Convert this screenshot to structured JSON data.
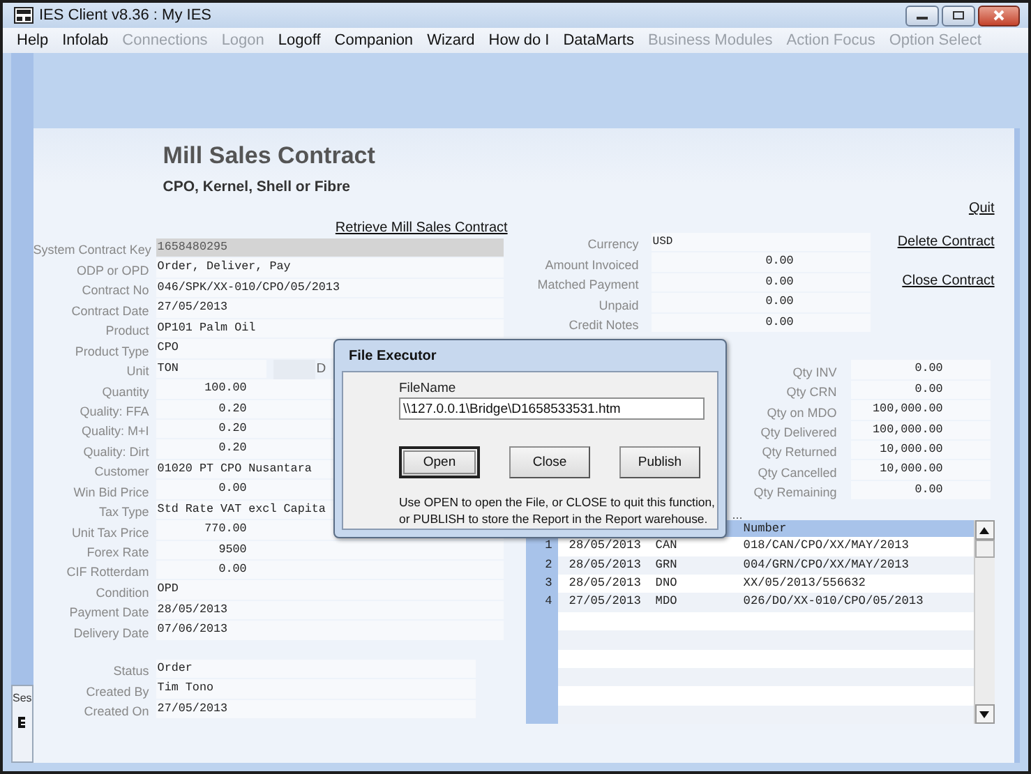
{
  "window": {
    "title": "IES Client v8.36 : My IES"
  },
  "menu": [
    {
      "label": "Help",
      "disabled": false
    },
    {
      "label": "Infolab",
      "disabled": false
    },
    {
      "label": "Connections",
      "disabled": true
    },
    {
      "label": "Logon",
      "disabled": true
    },
    {
      "label": "Logoff",
      "disabled": false
    },
    {
      "label": "Companion",
      "disabled": false
    },
    {
      "label": "Wizard",
      "disabled": false
    },
    {
      "label": "How do I",
      "disabled": false
    },
    {
      "label": "DataMarts",
      "disabled": false
    },
    {
      "label": "Business Modules",
      "disabled": true
    },
    {
      "label": "Action Focus",
      "disabled": true
    },
    {
      "label": "Option Select",
      "disabled": true
    }
  ],
  "form": {
    "title": "Mill Sales Contract",
    "subtitle": "CPO, Kernel, Shell or Fibre",
    "quit_link": "Quit",
    "retrieve_link": "Retrieve Mill Sales Contract",
    "fields": [
      {
        "label": "System Contract Key",
        "value": "1658480295",
        "kind": "key"
      },
      {
        "label": "ODP or OPD",
        "value": "Order, Deliver, Pay",
        "kind": "text"
      },
      {
        "label": "Contract No",
        "value": "046/SPK/XX-010/CPO/05/2013",
        "kind": "text"
      },
      {
        "label": "Contract Date",
        "value": "27/05/2013",
        "kind": "text"
      },
      {
        "label": "Product",
        "value": "OP101 Palm Oil",
        "kind": "text"
      },
      {
        "label": "Product Type",
        "value": "CPO",
        "kind": "text"
      },
      {
        "label": "Unit",
        "value": "TON",
        "kind": "short",
        "side_label": "D"
      },
      {
        "label": "Quantity",
        "value": "100.00",
        "kind": "number"
      },
      {
        "label": "Quality: FFA",
        "value": "0.20",
        "kind": "number"
      },
      {
        "label": "Quality: M+I",
        "value": "0.20",
        "kind": "number"
      },
      {
        "label": "Quality: Dirt",
        "value": "0.20",
        "kind": "number"
      },
      {
        "label": "Customer",
        "value": "01020 PT CPO Nusantara",
        "kind": "text"
      },
      {
        "label": "Win Bid Price",
        "value": "0.00",
        "kind": "number"
      },
      {
        "label": "Tax Type",
        "value": "Std Rate VAT excl Capita",
        "kind": "text"
      },
      {
        "label": "Unit Tax Price",
        "value": "770.00",
        "kind": "number"
      },
      {
        "label": "Forex Rate",
        "value": "9500",
        "kind": "number"
      },
      {
        "label": "CIF Rotterdam",
        "value": "0.00",
        "kind": "number"
      },
      {
        "label": "Condition",
        "value": "OPD",
        "kind": "text"
      },
      {
        "label": "Payment Date",
        "value": "28/05/2013",
        "kind": "text"
      },
      {
        "label": "Delivery Date",
        "value": "07/06/2013",
        "kind": "text"
      }
    ],
    "status_fields": [
      {
        "label": "Status",
        "value": "Order"
      },
      {
        "label": "Created By",
        "value": "Tim Tono"
      },
      {
        "label": "Created On",
        "value": "27/05/2013"
      }
    ],
    "finance_fields": [
      {
        "label": "Currency",
        "value": "USD",
        "kind": "text"
      },
      {
        "label": "Amount Invoiced",
        "value": "0.00",
        "kind": "number"
      },
      {
        "label": "Matched Payment",
        "value": "0.00",
        "kind": "number"
      },
      {
        "label": "Unpaid",
        "value": "0.00",
        "kind": "number"
      },
      {
        "label": "Credit Notes",
        "value": "0.00",
        "kind": "number"
      }
    ],
    "links": [
      "Delete Contract",
      "Close Contract"
    ],
    "quantity_fields": [
      {
        "label": "Qty INV",
        "value": "0.00"
      },
      {
        "label": "Qty CRN",
        "value": "0.00"
      },
      {
        "label": "Qty on MDO",
        "value": "100,000.00"
      },
      {
        "label": "Qty Delivered",
        "value": "100,000.00"
      },
      {
        "label": "Qty Returned",
        "value": "10,000.00"
      },
      {
        "label": "Qty Cancelled",
        "value": "10,000.00"
      },
      {
        "label": "Qty Remaining",
        "value": "0.00"
      }
    ],
    "table": {
      "overflow_label": "...",
      "columns": [
        "Number"
      ],
      "rows": [
        {
          "index": "1",
          "date": "28/05/2013",
          "type": "CAN",
          "number": "018/CAN/CPO/XX/MAY/2013"
        },
        {
          "index": "2",
          "date": "28/05/2013",
          "type": "GRN",
          "number": "004/GRN/CPO/XX/MAY/2013"
        },
        {
          "index": "3",
          "date": "28/05/2013",
          "type": "DNO",
          "number": "XX/05/2013/556632"
        },
        {
          "index": "4",
          "date": "27/05/2013",
          "type": "MDO",
          "number": "026/DO/XX-010/CPO/05/2013"
        }
      ]
    }
  },
  "session_panel": {
    "label": "Ses"
  },
  "dialog": {
    "title": "File Executor",
    "field_label": "FileName",
    "file_name": "\\\\127.0.0.1\\Bridge\\D1658533531.htm",
    "buttons": [
      {
        "label": "Open",
        "default": true
      },
      {
        "label": "Close",
        "default": false
      },
      {
        "label": "Publish",
        "default": false
      }
    ],
    "help_text": "Use OPEN to open the File, or CLOSE to quit this function, or PUBLISH to store the Report in the Report warehouse."
  }
}
